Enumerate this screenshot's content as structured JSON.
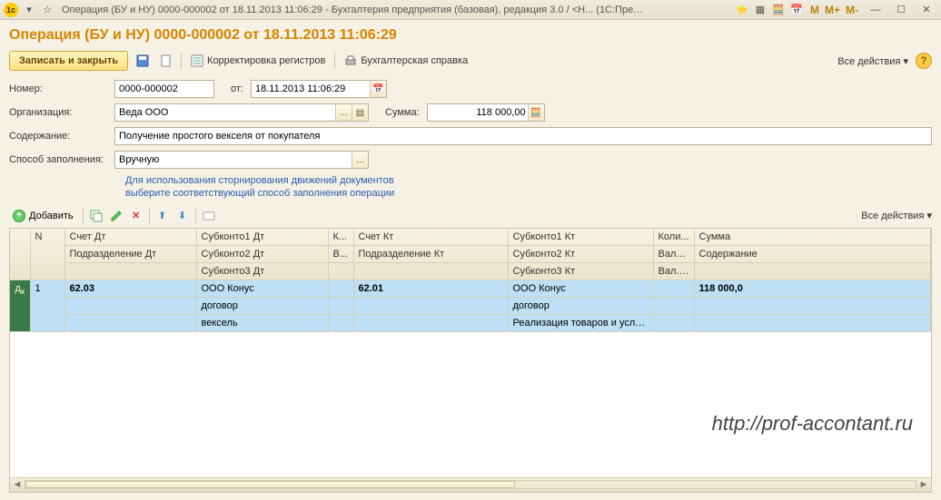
{
  "titlebar": {
    "title": "Операция (БУ и НУ) 0000-000002 от 18.11.2013 11:06:29 - Бухгалтерия предприятия (базовая), редакция 3.0 / <Н...   (1С:Предприятие)"
  },
  "heading": "Операция (БУ и НУ) 0000-000002 от 18.11.2013 11:06:29",
  "toolbar": {
    "save_close": "Записать и закрыть",
    "reg_correct": "Корректировка регистров",
    "acc_ref": "Бухгалтерская справка",
    "all_actions": "Все действия"
  },
  "form": {
    "labels": {
      "number": "Номер:",
      "from": "от:",
      "org": "Организация:",
      "sum": "Сумма:",
      "content": "Содержание:",
      "fill_method": "Способ заполнения:"
    },
    "number": "0000-000002",
    "date": "18.11.2013 11:06:29",
    "org": "Веда ООО",
    "sum": "118 000,00",
    "content": "Получение простого векселя от покупателя",
    "fill_method": "Вручную",
    "hint_line1": "Для использования сторнирования движений документов",
    "hint_line2": "выберите соответствующий способ заполнения операции"
  },
  "row_toolbar": {
    "add": "Добавить",
    "all_actions": "Все действия"
  },
  "grid": {
    "headers": {
      "n": "N",
      "acc_dt": "Счет Дт",
      "sub_dt1": "Субконто1 Дт",
      "k": "К...",
      "acc_kt": "Счет Кт",
      "sub_kt1": "Субконто1 Кт",
      "qty": "Коли...",
      "sum": "Сумма",
      "div_dt": "Подразделение Дт",
      "sub_dt2": "Субконто2 Дт",
      "v": "В...",
      "div_kt": "Подразделение Кт",
      "sub_kt2": "Субконто2 Кт",
      "curr": "Валю...",
      "content": "Содержание",
      "sub_dt3": "Субконто3 Дт",
      "sub_kt3": "Субконто3 Кт",
      "val": "Вал. ..."
    },
    "row": {
      "n": "1",
      "acc_dt": "62.03",
      "sub_dt1": "ООО Конус",
      "acc_kt": "62.01",
      "sub_kt1": "ООО Конус",
      "sum": "118 000,0",
      "sub_dt2": "договор",
      "sub_kt2": "договор",
      "sub_dt3": "вексель",
      "sub_kt3": "Реализация товаров и услуг ..."
    }
  },
  "watermark": "http://prof-accontant.ru"
}
